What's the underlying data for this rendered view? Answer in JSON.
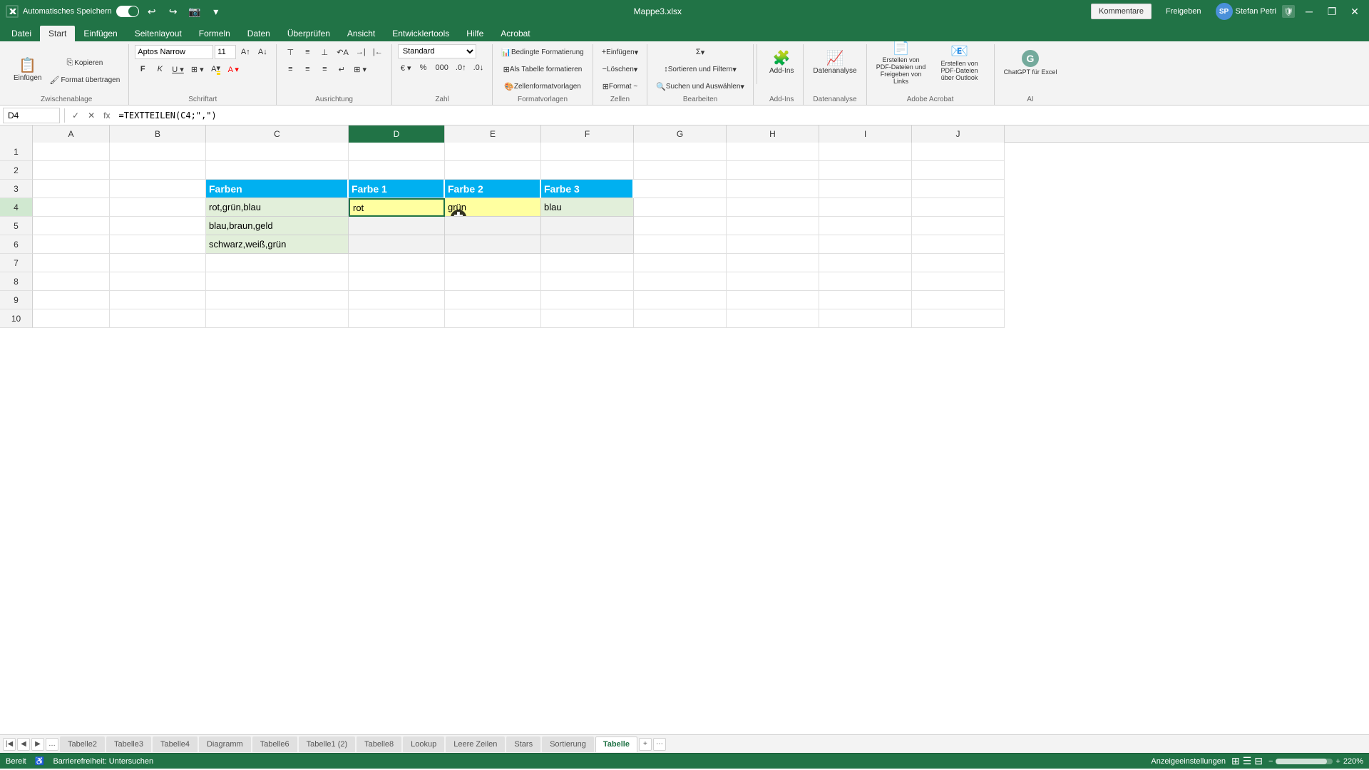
{
  "titlebar": {
    "autosave_label": "Automatisches Speichern",
    "filename": "Mappe3.xlsx",
    "user_name": "Stefan Petri",
    "user_initials": "SP",
    "minimize_icon": "─",
    "restore_icon": "❐",
    "close_icon": "✕"
  },
  "menu": {
    "items": [
      "Datei",
      "Start",
      "Einfügen",
      "Seitenlayout",
      "Formeln",
      "Daten",
      "Überprüfen",
      "Ansicht",
      "Entwicklertools",
      "Hilfe",
      "Acrobat"
    ]
  },
  "ribbon": {
    "active_tab": "Start",
    "tabs": [
      "Datei",
      "Start",
      "Einfügen",
      "Seitenlayout",
      "Formeln",
      "Daten",
      "Überprüfen",
      "Ansicht",
      "Entwicklertools",
      "Hilfe",
      "Acrobat"
    ],
    "groups": {
      "zwischenablage": "Zwischenablage",
      "schriftart": "Schriftart",
      "ausrichtung": "Ausrichtung",
      "zahl": "Zahl",
      "formatvorlagen": "Formatvorlagen",
      "zellen": "Zellen",
      "bearbeiten": "Bearbeiten",
      "add_ins": "Add-Ins",
      "analyse": "Datenanalyse",
      "pdf": "Adobe Acrobat",
      "ai": "AI"
    },
    "font_name": "Aptos Narrow",
    "font_size": "11",
    "number_format": "Standard",
    "buttons": {
      "einfuegen": "Einfügen",
      "kopieren": "Kopieren",
      "format_uebertragen": "Format übertragen",
      "fett": "F",
      "kursiv": "K",
      "unterstreichen": "U",
      "rahmen": "Rahmen",
      "fuellfarbe": "Füllfarbe",
      "schriftfarbe": "Schriftfarbe",
      "links": "Links",
      "zentriert": "Zentriert",
      "rechts": "Rechts",
      "bedingte_formatierung": "Bedingte Formatierung",
      "als_tabelle": "Als Tabelle formatieren",
      "zellenformatvorlagen": "Zellenformatvorlagen",
      "einfuegen2": "Einfügen",
      "loeschen": "Löschen",
      "format": "Format ~",
      "summe": "Summe",
      "sortieren": "Sortieren und Filtern",
      "suchen": "Suchen und Auswählen",
      "add_ins": "Add-Ins",
      "datenanalyse": "Datenanalyse",
      "pdf_erstellen": "Erstellen von PDF-Dateien und Freigeben von Links",
      "pdf_dateien": "Erstellen von PDF-Dateien über Outlook",
      "chatgpt": "ChatGPT für Excel",
      "kommentare": "Kommentare",
      "freigeben": "Freigeben"
    }
  },
  "formula_bar": {
    "cell_name": "D4",
    "formula": "=TEXTTEILEN(C4;\",\")"
  },
  "columns": {
    "labels": [
      "A",
      "B",
      "C",
      "D",
      "E",
      "F",
      "G",
      "H",
      "I",
      "J"
    ],
    "widths": [
      108,
      135,
      200,
      135,
      135,
      130,
      130,
      130,
      130,
      130
    ],
    "active": "D"
  },
  "rows": {
    "count": 10,
    "active": 4
  },
  "table": {
    "headers": {
      "row": 3,
      "cols": {
        "C": "Farben",
        "D": "Farbe 1",
        "E": "Farbe 2",
        "F": "Farbe 3"
      }
    },
    "data": [
      {
        "row": 4,
        "C": "rot,grün,blau",
        "D": "rot",
        "E": "grün",
        "F": "blau",
        "selected_col": "D"
      },
      {
        "row": 5,
        "C": "blau,braun,geld",
        "D": "",
        "E": "",
        "F": ""
      },
      {
        "row": 6,
        "C": "schwarz,weiß,grün",
        "D": "",
        "E": "",
        "F": ""
      }
    ],
    "header_bg": "#00b0f0",
    "data_bg": "#e2efda",
    "empty_bg": "#f2f2f2",
    "selected_bg": "#ffff88"
  },
  "sheet_tabs": {
    "tabs": [
      "Tabelle2",
      "Tabelle3",
      "Tabelle4",
      "Diagramm",
      "Tabelle6",
      "Tabelle1 (2)",
      "Tabelle8",
      "Lookup",
      "Leere Zeilen",
      "Stars",
      "Sortierung",
      "Tabelle"
    ],
    "active": "Tabelle"
  },
  "status_bar": {
    "left": {
      "ready": "Bereit",
      "accessibility": "Barrierefreiheit: Untersuchen"
    },
    "right": {
      "settings": "Anzeigeeinstellungen",
      "zoom": "220%"
    }
  }
}
